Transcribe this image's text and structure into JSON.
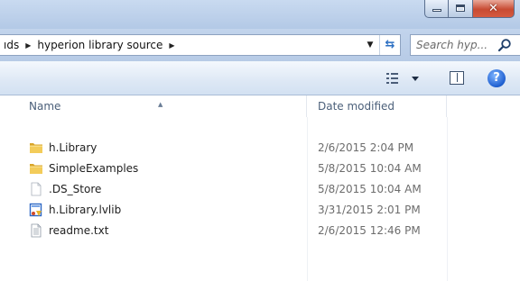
{
  "window": {
    "minimize_icon": "minimize-icon",
    "maximize_icon": "maximize-icon",
    "close_icon": "close-icon"
  },
  "address": {
    "crumbs": [
      "ıds",
      "hyperion library source"
    ],
    "search_placeholder": "Search hyp..."
  },
  "toolbar": {
    "icons": [
      "views-icon",
      "preview-pane-icon",
      "help-icon"
    ]
  },
  "columns": {
    "name": "Name",
    "date_modified": "Date modified"
  },
  "files": [
    {
      "name": "h.Library",
      "date": "2/6/2015 2:04 PM",
      "icon": "folder-icon"
    },
    {
      "name": "SimpleExamples",
      "date": "5/8/2015 10:04 AM",
      "icon": "folder-icon"
    },
    {
      "name": ".DS_Store",
      "date": "5/8/2015 10:04 AM",
      "icon": "file-icon"
    },
    {
      "name": "h.Library.lvlib",
      "date": "3/31/2015 2:01 PM",
      "icon": "labview-library-icon"
    },
    {
      "name": "readme.txt",
      "date": "2/6/2015 12:46 PM",
      "icon": "text-file-icon"
    }
  ]
}
